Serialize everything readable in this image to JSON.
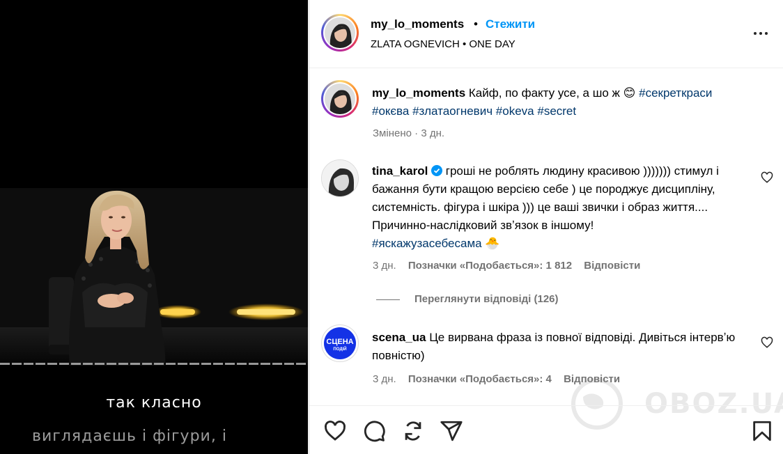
{
  "post": {
    "author": "my_lo_moments",
    "separator": "•",
    "follow_label": "Стежити",
    "audio": "ZLATA OGNEVICH • ONE DAY",
    "more_icon": "more-horizontal-icon"
  },
  "video": {
    "subtitle_main": "так класно",
    "subtitle_next": "виглядаєшь і фігури, і"
  },
  "caption": {
    "author": "my_lo_moments",
    "text": "Кайф, по факту усе, а шо ж 😊",
    "tags": [
      "#секреткраси",
      "#окєва",
      "#златаогневич",
      "#okeva",
      "#secret"
    ],
    "edited_label": "Змінено",
    "time": "3 дн."
  },
  "comments": [
    {
      "author": "tina_karol",
      "verified": true,
      "text": "гроші не роблять людину красивою ))))))) стимул і бажання бути кращою версією себе ) це породжує дисципліну, системність. фігура і шкіра ))) це ваші звички і образ життя.... Причинно-наслідковий звʼязок в іншому!",
      "tag": "#яскажузасебесама",
      "emoji": "🐣",
      "time": "3 дн.",
      "likes_label": "Позначки «Подобається»: 1 812",
      "reply_label": "Відповісти",
      "view_replies": "Переглянути відповіді (126)"
    },
    {
      "author": "scena_ua",
      "avatar_text_1": "СЦЕНА",
      "avatar_text_2": "ПОДІЙ",
      "text": "Це вирвана фраза із повної відповіді. Дивіться інтервʼю повністю)",
      "time": "3 дн.",
      "likes_label": "Позначки «Подобається»: 4",
      "reply_label": "Відповісти"
    }
  ],
  "watermark": "OBOZ.UA",
  "actions": [
    "heart-icon",
    "comment-icon",
    "share-icon",
    "send-icon",
    "bookmark-icon"
  ],
  "colors": {
    "link": "#0095f6",
    "hashtag": "#00376b",
    "secondary_text": "#737373",
    "scena_blue": "#1432e6"
  }
}
